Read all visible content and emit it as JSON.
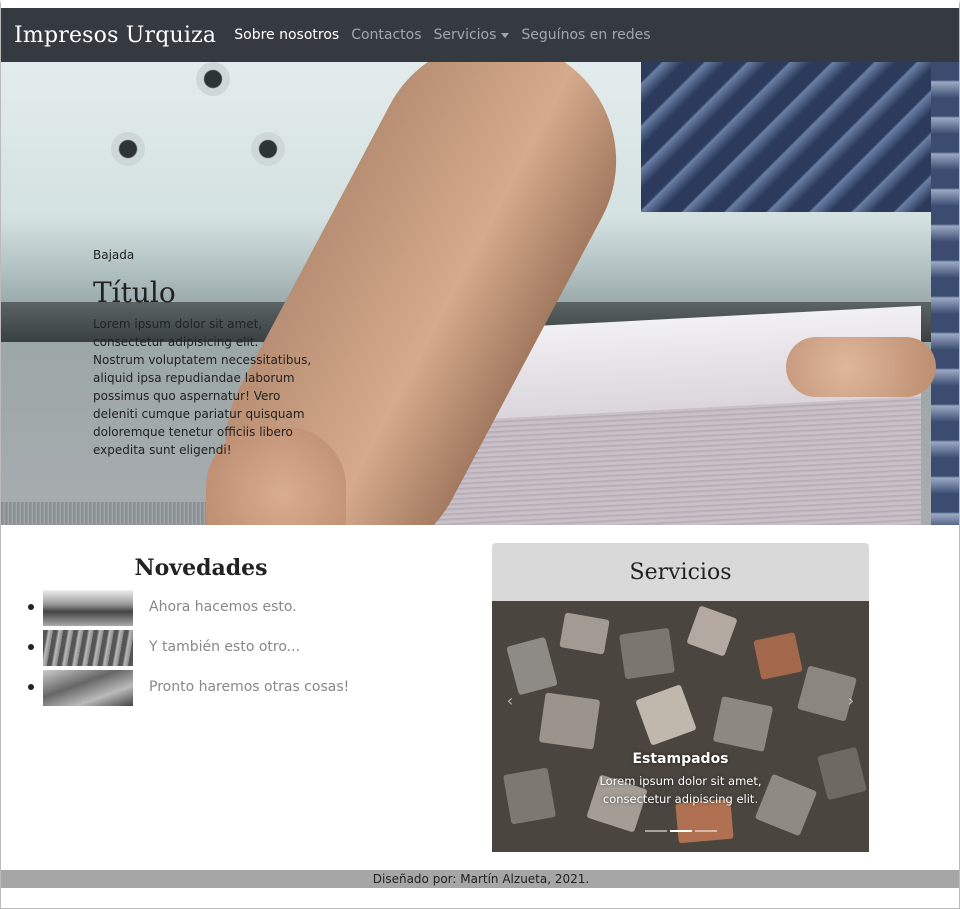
{
  "navbar": {
    "brand": "Impresos Urquiza",
    "links": [
      {
        "label": "Sobre nosotros",
        "active": true
      },
      {
        "label": "Contactos"
      },
      {
        "label": "Servicios",
        "dropdown": true
      },
      {
        "label": "Seguínos en redes"
      }
    ]
  },
  "hero": {
    "subtitle": "Bajada",
    "title": "Título",
    "text": "Lorem ipsum dolor sit amet, consectetur adipisicing elit. Nostrum voluptatem necessitatibus, aliquid ipsa repudiandae laborum possimus quo aspernatur! Vero deleniti cumque pariatur quisquam doloremque tenetur officiis libero expedita sunt eligendi!"
  },
  "novedades": {
    "title": "Novedades",
    "items": [
      {
        "label": "Ahora hacemos esto."
      },
      {
        "label": "Y también esto otro..."
      },
      {
        "label": "Pronto haremos otras cosas!"
      }
    ]
  },
  "servicios": {
    "title": "Servicios",
    "slide": {
      "title": "Estampados",
      "text": "Lorem ipsum dolor sit amet, consectetur adipiscing elit."
    },
    "prev_icon": "‹",
    "next_icon": "›"
  },
  "footer": {
    "text": "Diseñado por: Martín Alzueta, 2021."
  },
  "colors": {
    "navbar_bg": "#343a40",
    "card_header_bg": "#d9d9d9",
    "footer_bg": "#a6a6a6"
  }
}
